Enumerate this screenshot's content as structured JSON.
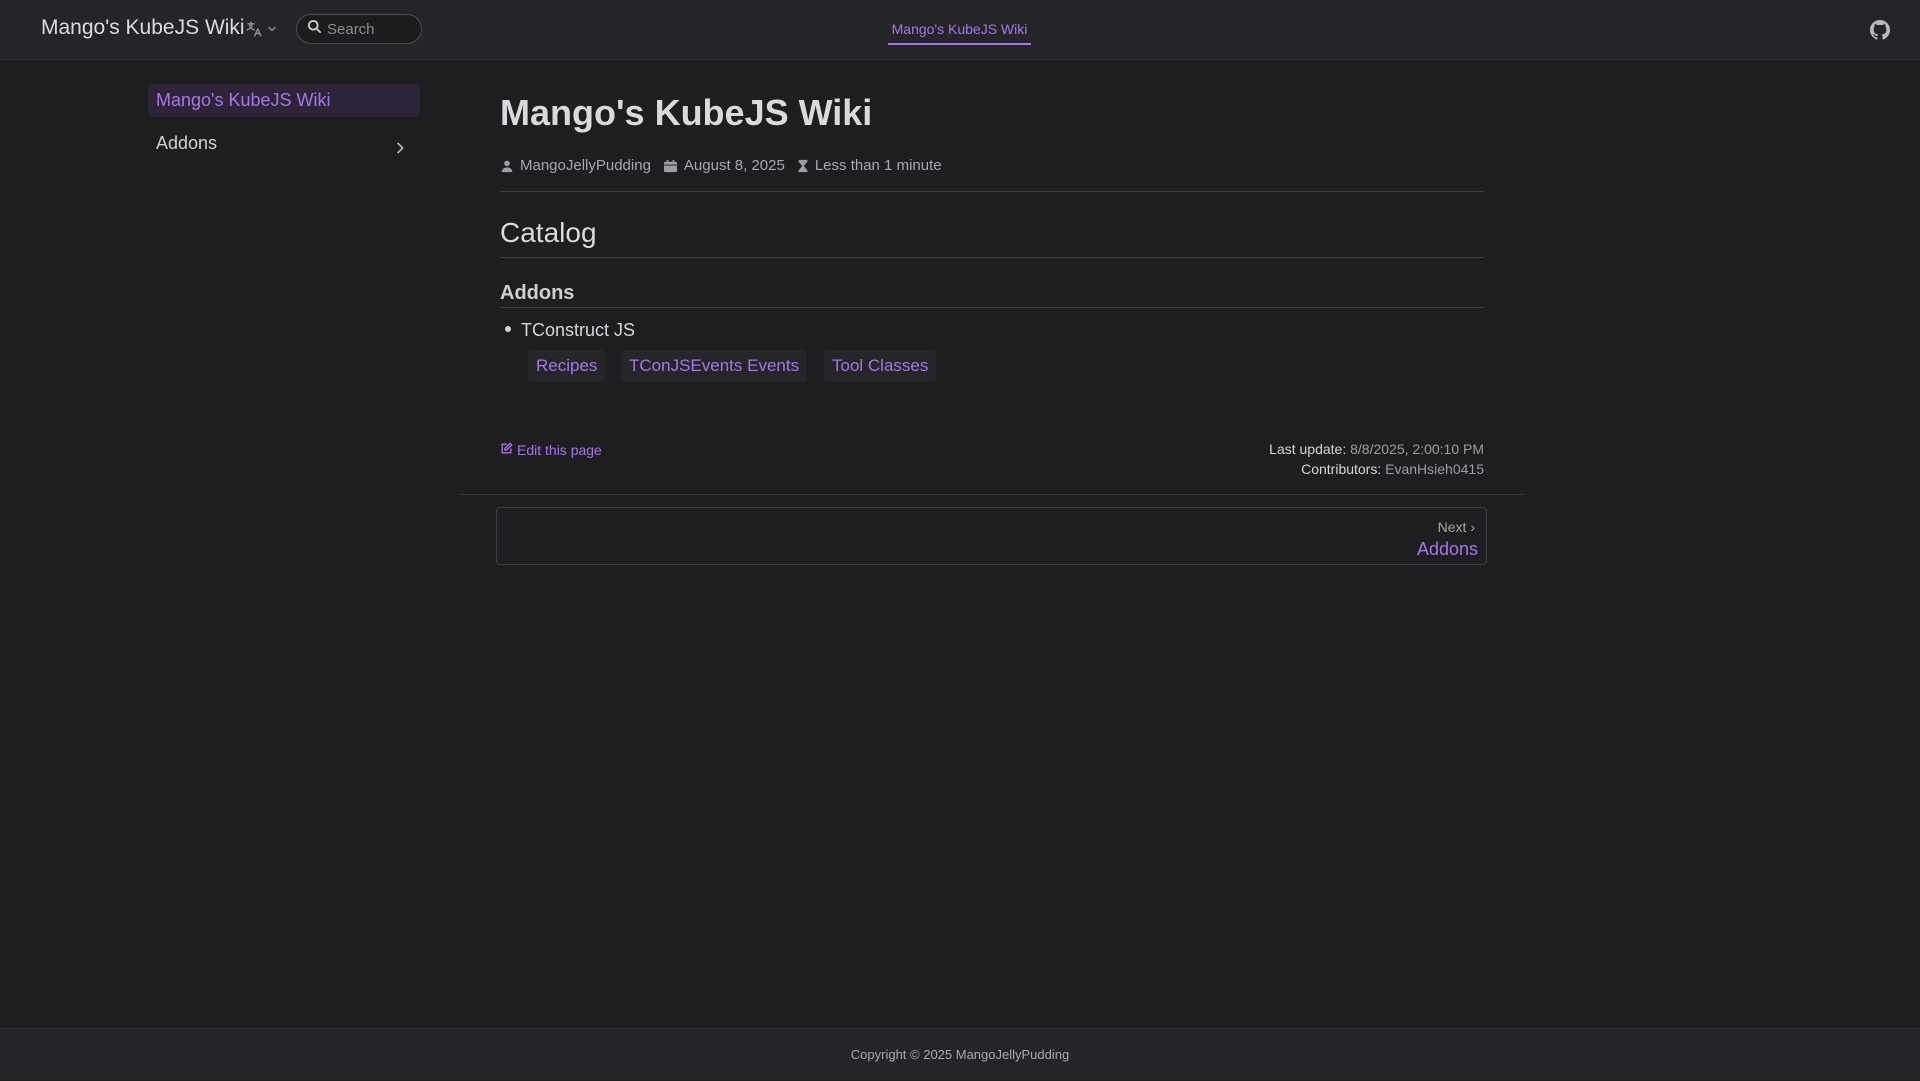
{
  "navbar": {
    "brand": "Mango's KubeJS Wiki",
    "search_placeholder": "Search",
    "nav_link": "Mango's KubeJS Wiki",
    "icons": {
      "language": "translate-icon",
      "dropdown": "chevron-down-icon",
      "search": "search-icon",
      "repo": "github-icon"
    }
  },
  "sidebar": {
    "items": [
      {
        "label": "Mango's KubeJS Wiki",
        "active": true
      },
      {
        "label": "Addons",
        "active": false,
        "expandable": true
      }
    ]
  },
  "article": {
    "title": "Mango's KubeJS Wiki",
    "author": "MangoJellyPudding",
    "date": "August 8, 2025",
    "reading_time": "Less than 1 minute",
    "catalog_heading": "Catalog",
    "addons_heading": "Addons",
    "list": [
      {
        "label": "TConstruct JS",
        "links": [
          "Recipes",
          "TConJSEvents Events",
          "Tool Classes"
        ]
      }
    ]
  },
  "page_meta": {
    "edit_label": "Edit this page",
    "last_update_label": "Last update:",
    "last_update_value": "8/8/2025, 2:00:10 PM",
    "contributors_label": "Contributors:",
    "contributors_value": "EvanHsieh0415"
  },
  "pager": {
    "next_label": "Next ›",
    "next_title": "Addons"
  },
  "footer": {
    "copyright": "Copyright © 2025 MangoJellyPudding"
  },
  "colors": {
    "accent": "#a775ea",
    "background": "#1e1e20",
    "navbar": "#252529"
  }
}
